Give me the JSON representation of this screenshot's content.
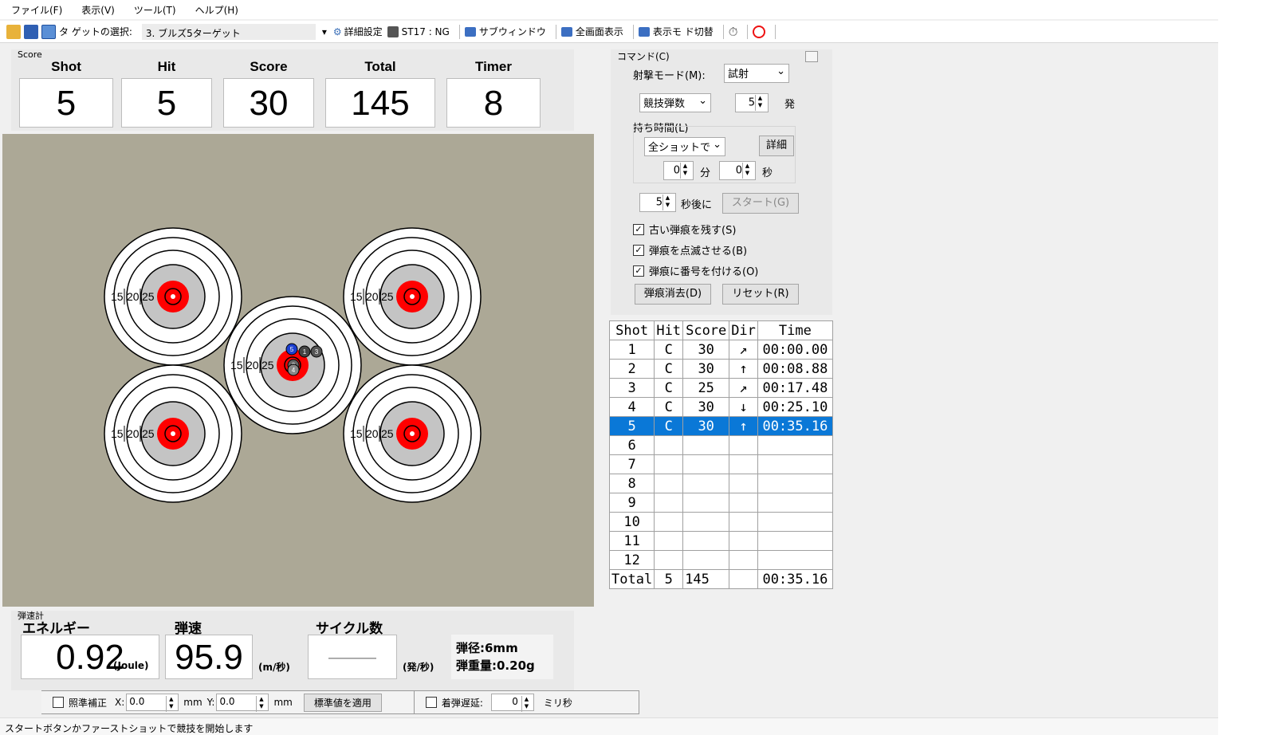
{
  "menu": [
    "ファイル(F)",
    "表示(V)",
    "ツール(T)",
    "ヘルプ(H)"
  ],
  "toolbar": {
    "target_label": "タ ゲットの選択:",
    "target_value": "3. ブルズ5ターゲット",
    "detail_settings": "詳細設定",
    "st17": "ST17 : NG",
    "subwindow": "サブウィンドウ",
    "fullscreen": "全画面表示",
    "display_switch": "表示モ ド切替"
  },
  "score": {
    "group_label": "Score",
    "shot_label": "Shot",
    "shot_value": "5",
    "hit_label": "Hit",
    "hit_value": "5",
    "score_label": "Score",
    "score_value": "30",
    "total_label": "Total",
    "total_value": "145",
    "timer_label": "Timer",
    "timer_value": "8"
  },
  "targets": {
    "ring_labels": [
      "15",
      "20",
      "25"
    ],
    "shots": [
      "5",
      "1",
      "3",
      "2",
      "4"
    ]
  },
  "ballistic": {
    "group_label": "弾速計",
    "energy_label": "エネルギー",
    "energy_value": "0.92",
    "energy_unit": "(Joule)",
    "speed_label": "弾速",
    "speed_value": "95.9",
    "speed_unit": "(m/秒)",
    "cycle_label": "サイクル数",
    "cycle_value": "———",
    "cycle_unit": "(発/秒)",
    "caliber": "弾径:6mm",
    "weight": "弾重量:0.20g"
  },
  "bottom": {
    "aim_label": "照準補正",
    "x_label": "X:",
    "x_value": "0.0",
    "x_unit": "mm",
    "y_label": "Y:",
    "y_value": "0.0",
    "y_unit": "mm",
    "apply_button": "標準値を適用",
    "delay_label": "着弾遅延:",
    "delay_value": "0",
    "delay_unit": "ミリ秒"
  },
  "status": "スタートボタンかファーストショットで競技を開始します",
  "command": {
    "group_label": "コマンド(C)",
    "mode_label": "射撃モード(M):",
    "mode_value": "試射",
    "count_mode": "競技弾数",
    "count_value": "5",
    "count_unit": "発",
    "time_group": "持ち時間(L)",
    "time_mode": "全ショットで",
    "detail_button": "詳細",
    "min_value": "0",
    "min_unit": "分",
    "sec_value": "0",
    "sec_unit": "秒",
    "delay_value": "5",
    "delay_unit": "秒後に",
    "start_button": "スタート(G)",
    "check_keep": "古い弾痕を残す(S)",
    "check_blink": "弾痕を点滅させる(B)",
    "check_number": "弾痕に番号を付ける(O)",
    "clear_button": "弾痕消去(D)",
    "reset_button": "リセット(R)"
  },
  "table": {
    "headers": [
      "Shot",
      "Hit",
      "Score",
      "Dir",
      "Time"
    ],
    "rows": [
      [
        "1",
        "C",
        "30",
        "↗",
        "00:00.00"
      ],
      [
        "2",
        "C",
        "30",
        "↑",
        "00:08.88"
      ],
      [
        "3",
        "C",
        "25",
        "↗",
        "00:17.48"
      ],
      [
        "4",
        "C",
        "30",
        "↓",
        "00:25.10"
      ],
      [
        "5",
        "C",
        "30",
        "↑",
        "00:35.16"
      ],
      [
        "6",
        "",
        "",
        "",
        ""
      ],
      [
        "7",
        "",
        "",
        "",
        ""
      ],
      [
        "8",
        "",
        "",
        "",
        ""
      ],
      [
        "9",
        "",
        "",
        "",
        ""
      ],
      [
        "10",
        "",
        "",
        "",
        ""
      ],
      [
        "11",
        "",
        "",
        "",
        ""
      ],
      [
        "12",
        "",
        "",
        "",
        ""
      ]
    ],
    "selected_row": 4,
    "total": [
      "Total",
      "5",
      "145",
      "",
      "00:35.16"
    ]
  },
  "colors": {
    "target_bg": "#aca896",
    "bull": "#ff0000",
    "select": "#0a78d7"
  }
}
